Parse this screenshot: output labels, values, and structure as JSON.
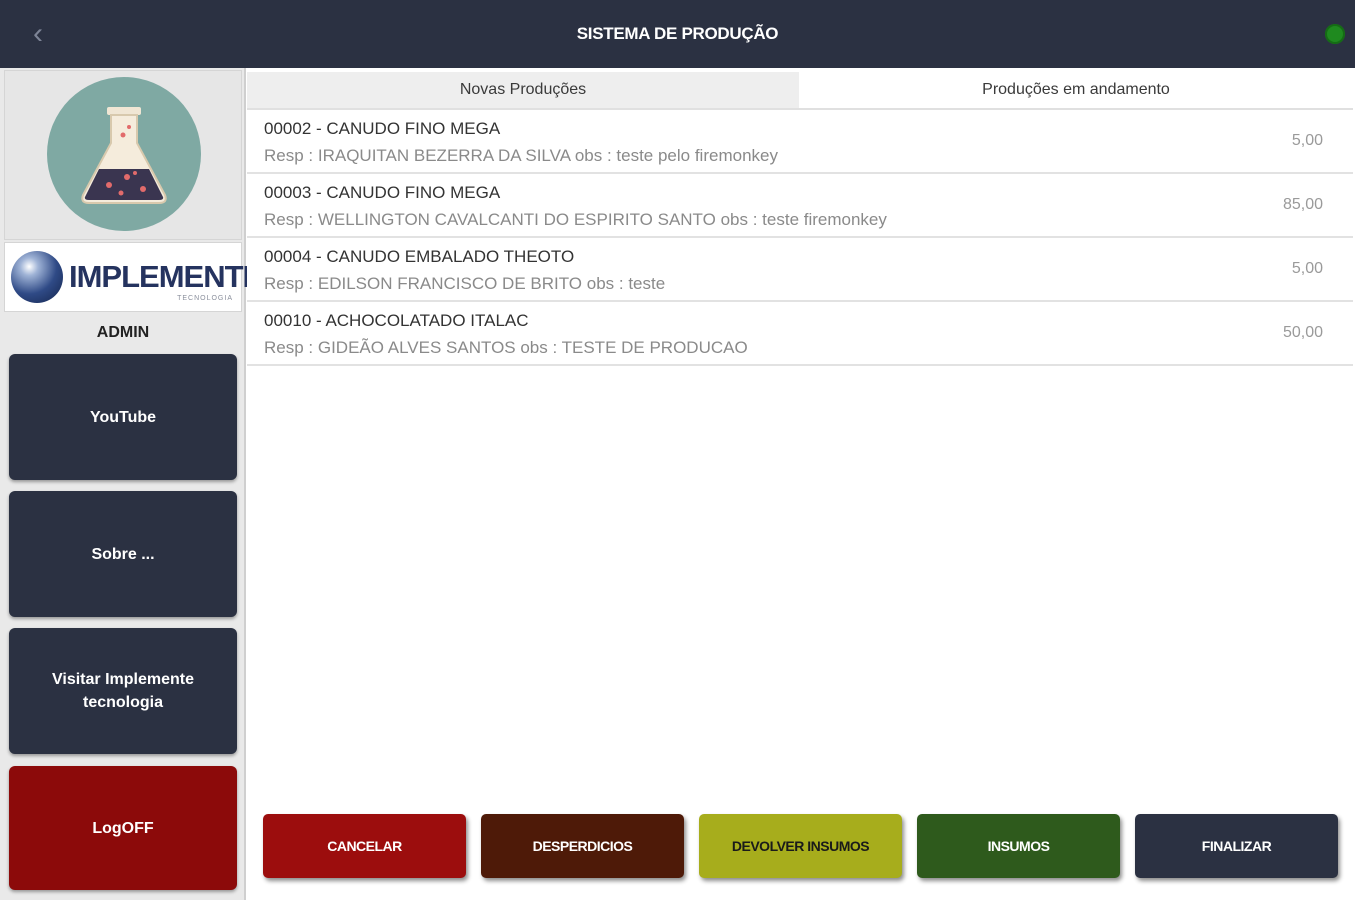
{
  "header": {
    "title": "SISTEMA DE PRODUÇÃO",
    "back_icon": "‹"
  },
  "sidebar": {
    "logo_text": "IMPLEMENTE",
    "logo_sub": "TECNOLOGIA",
    "user": "ADMIN",
    "buttons": [
      {
        "label": "YouTube"
      },
      {
        "label": "Sobre ..."
      },
      {
        "label": "Visitar Implemente\ntecnologia"
      },
      {
        "label": "LogOFF"
      }
    ]
  },
  "tabs": [
    {
      "label": "Novas Produções"
    },
    {
      "label": "Produções em andamento"
    }
  ],
  "productions": [
    {
      "title": "00002 - CANUDO FINO MEGA",
      "subtitle": "Resp : IRAQUITAN BEZERRA DA SILVA obs  : teste pelo firemonkey",
      "value": "5,00"
    },
    {
      "title": "00003 - CANUDO FINO MEGA",
      "subtitle": "Resp : WELLINGTON CAVALCANTI DO ESPIRITO SANTO obs  : teste firemonkey",
      "value": "85,00"
    },
    {
      "title": "00004 - CANUDO EMBALADO THEOTO",
      "subtitle": "Resp : EDILSON FRANCISCO DE BRITO obs  : teste",
      "value": "5,00"
    },
    {
      "title": "00010 - ACHOCOLATADO ITALAC",
      "subtitle": "Resp : GIDEÃO ALVES SANTOS obs  : TESTE DE PRODUCAO",
      "value": "50,00"
    }
  ],
  "actions": [
    {
      "label": "CANCELAR",
      "color": "#9c0d0d"
    },
    {
      "label": "DESPERDICIOS",
      "color": "#4e1a08"
    },
    {
      "label": "DEVOLVER INSUMOS",
      "color": "#a7ad1c"
    },
    {
      "label": "INSUMOS",
      "color": "#2e5a1c"
    },
    {
      "label": "FINALIZAR",
      "color": "#2b3142"
    }
  ],
  "colors": {
    "header_bg": "#2b3142",
    "status_online": "#1f8a1f",
    "logoff_bg": "#8c0a0a"
  }
}
